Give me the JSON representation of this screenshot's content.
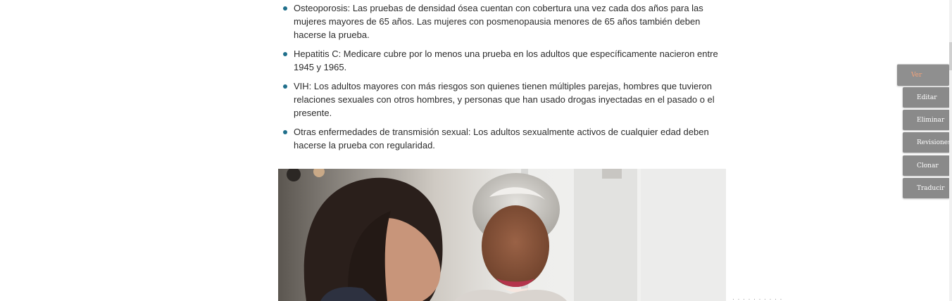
{
  "article": {
    "bullets": [
      "Osteoporosis: Las pruebas de densidad ósea cuentan con cobertura una vez cada dos años para las mujeres mayores de 65 años. Las mujeres con posmenopausia menores de 65 años también deben hacerse la prueba.",
      "Hepatitis C: Medicare cubre por lo menos una prueba en los adultos que específicamente nacieron entre 1945 y 1965.",
      "VIH: Los adultos mayores con más riesgos son quienes tienen múltiples parejas, hombres que tuvieron relaciones sexuales con otros hombres, y personas que han usado drogas inyectadas en el pasado o el presente.",
      "Otras enfermedades de transmisión sexual: Los adultos sexualmente activos de cualquier edad deben hacerse la prueba con regularidad."
    ],
    "bullet_color": "#1f6f8b",
    "image_icon": "photo-older-woman-with-caregiver"
  },
  "admin_tabs": {
    "active": "Ver",
    "items": [
      "Editar",
      "Eliminar",
      "Revisiones",
      "Clonar",
      "Traducir"
    ],
    "active_text_color": "#f4a27a",
    "tab_color": "#8a8a8a"
  }
}
